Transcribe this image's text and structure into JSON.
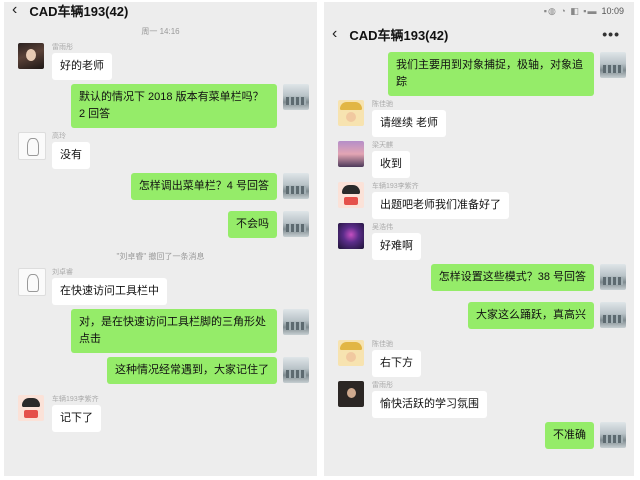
{
  "left": {
    "title": "CAD车辆193(42)",
    "time": "周一 14:16",
    "recall_notice": "\"刘卓睿\" 撤回了一条消息",
    "messages": [
      {
        "side": "in",
        "sender": "雷雨彤",
        "text": "好的老师",
        "avatar": "dark"
      },
      {
        "side": "out",
        "text": "默认的情况下 2018 版本有菜单栏吗？2 回答",
        "avatar": "city"
      },
      {
        "side": "in",
        "sender": "高玲",
        "text": "没有",
        "avatar": "sketch"
      },
      {
        "side": "out",
        "text": "怎样调出菜单栏？4 号回答",
        "avatar": "city"
      },
      {
        "side": "out",
        "text": "不会吗",
        "avatar": "city"
      },
      {
        "side": "in",
        "sender": "刘卓睿",
        "text": "在快速访问工具栏中",
        "avatar": "sketch"
      },
      {
        "side": "out",
        "text": "对，是在快速访问工具栏脚的三角形处点击",
        "avatar": "city"
      },
      {
        "side": "out",
        "text": "这种情况经常遇到，大家记住了",
        "avatar": "city"
      },
      {
        "side": "in",
        "sender": "车辆193李紫齐",
        "text": "记下了",
        "avatar": "cartoon"
      }
    ]
  },
  "right": {
    "status_time": "10:09",
    "title": "CAD车辆193(42)",
    "messages": [
      {
        "side": "out",
        "text": "我们主要用到对象捕捉，极轴，对象追踪",
        "avatar": "city"
      },
      {
        "side": "in",
        "sender": "陈佳驰",
        "text": "请继续 老师",
        "avatar": "luffy"
      },
      {
        "side": "in",
        "sender": "梁天麒",
        "text": "收到",
        "avatar": "sunset"
      },
      {
        "side": "in",
        "sender": "车辆193李紫齐",
        "text": "出题吧老师我们准备好了",
        "avatar": "cartoon"
      },
      {
        "side": "in",
        "sender": "吴浩伟",
        "text": "好难啊",
        "avatar": "neon"
      },
      {
        "side": "out",
        "text": "怎样设置这些模式？38 号回答",
        "avatar": "city"
      },
      {
        "side": "out",
        "text": "大家这么踊跃，真高兴",
        "avatar": "city"
      },
      {
        "side": "in",
        "sender": "陈佳驰",
        "text": "右下方",
        "avatar": "luffy"
      },
      {
        "side": "in",
        "sender": "雷雨彤",
        "text": "愉快活跃的学习氛围",
        "avatar": "black"
      },
      {
        "side": "out",
        "text": "不准确",
        "avatar": "city"
      }
    ]
  }
}
